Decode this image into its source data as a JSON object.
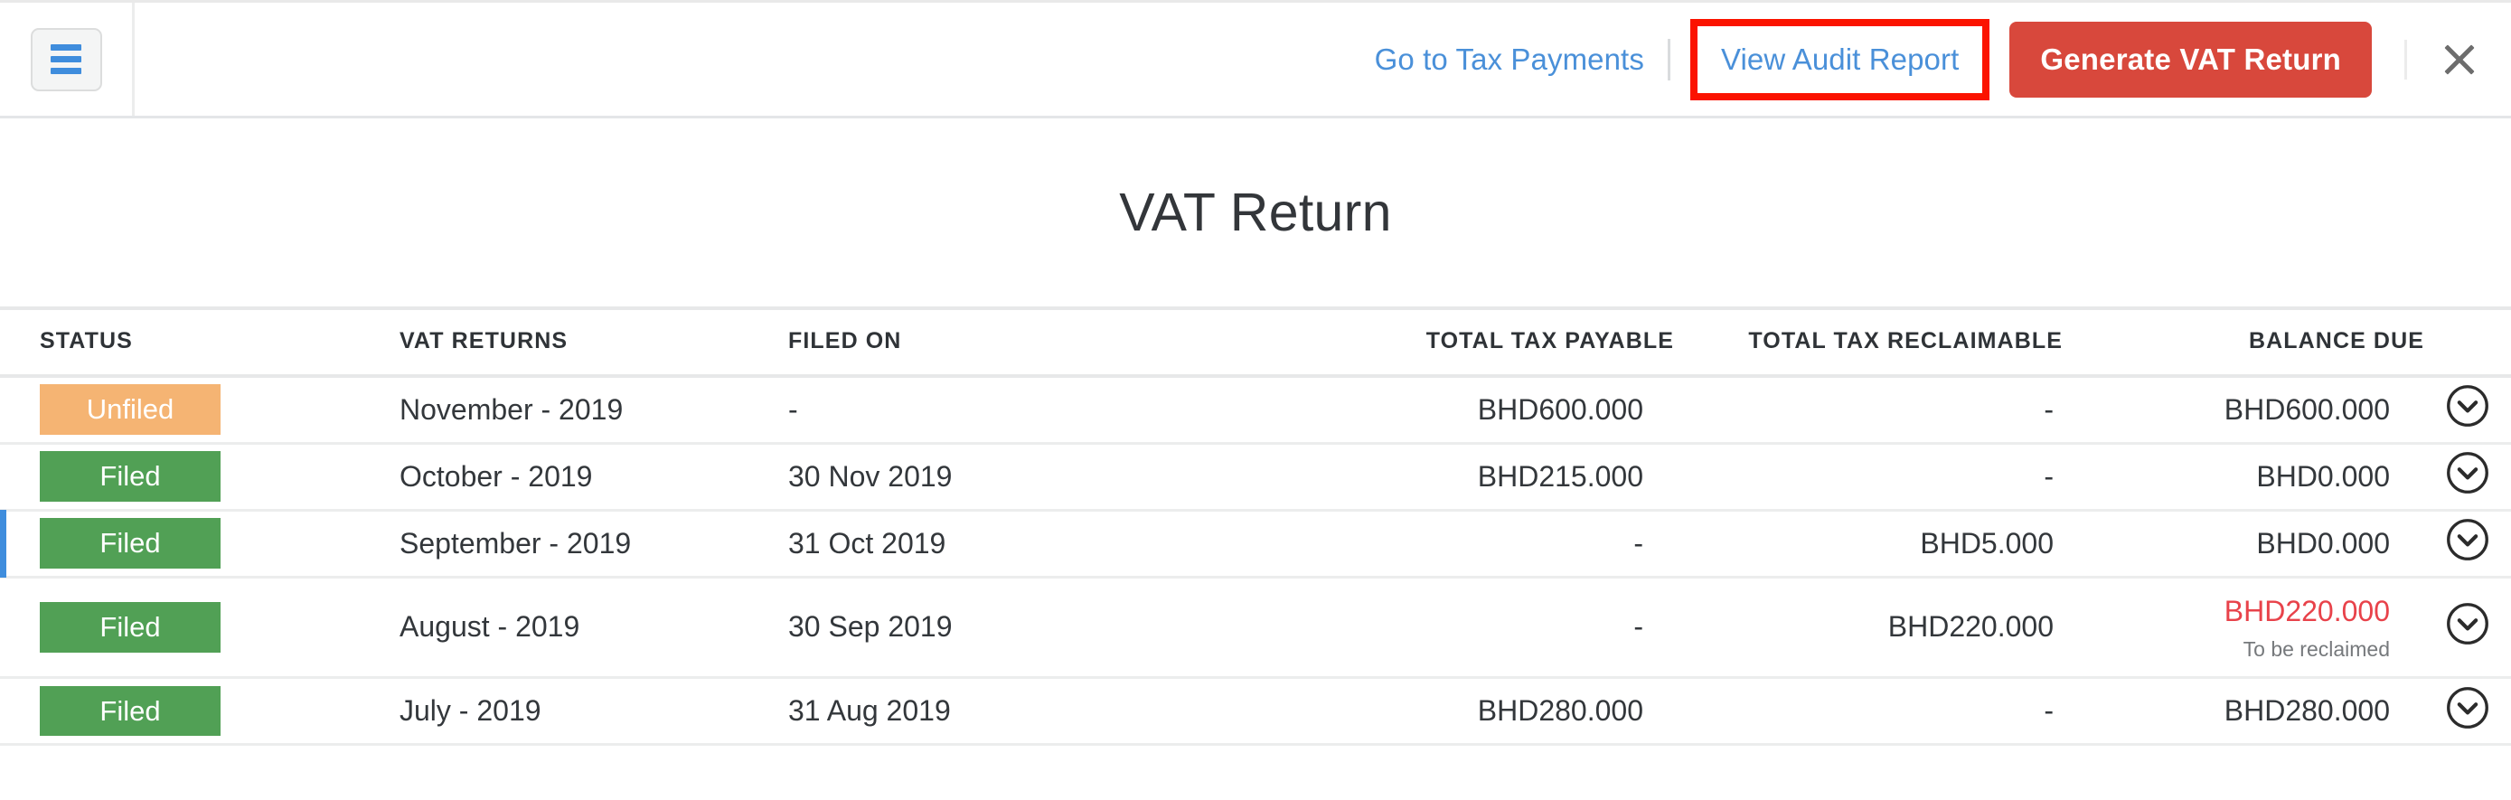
{
  "topbar": {
    "menu_icon": "hamburger-menu-icon",
    "tax_payments_link": "Go to Tax Payments",
    "audit_report_link": "View Audit Report",
    "generate_button": "Generate VAT Return",
    "close_icon": "close-icon",
    "highlight_color": "#fb1300",
    "link_color": "#4a90d9",
    "button_color": "#d8483c"
  },
  "page": {
    "title": "VAT Return"
  },
  "table": {
    "columns": [
      "STATUS",
      "VAT RETURNS",
      "FILED ON",
      "TOTAL TAX PAYABLE",
      "TOTAL TAX RECLAIMABLE",
      "BALANCE DUE"
    ],
    "status_colors": {
      "Unfiled": "#f5b473",
      "Filed": "#51a055"
    },
    "rows": [
      {
        "status": "Unfiled",
        "status_kind": "unfiled",
        "vat_return": "November - 2019",
        "filed_on": "-",
        "tax_payable": "BHD600.000",
        "tax_reclaimable": "-",
        "balance_due": "BHD600.000",
        "balance_note": "",
        "balance_negative": false,
        "accented": false,
        "action_icon": "chevron-down-circle-icon"
      },
      {
        "status": "Filed",
        "status_kind": "filed",
        "vat_return": "October - 2019",
        "filed_on": "30 Nov 2019",
        "tax_payable": "BHD215.000",
        "tax_reclaimable": "-",
        "balance_due": "BHD0.000",
        "balance_note": "",
        "balance_negative": false,
        "accented": false,
        "action_icon": "chevron-down-circle-icon"
      },
      {
        "status": "Filed",
        "status_kind": "filed",
        "vat_return": "September - 2019",
        "filed_on": "31 Oct 2019",
        "tax_payable": "-",
        "tax_reclaimable": "BHD5.000",
        "balance_due": "BHD0.000",
        "balance_note": "",
        "balance_negative": false,
        "accented": true,
        "action_icon": "chevron-down-circle-icon"
      },
      {
        "status": "Filed",
        "status_kind": "filed",
        "vat_return": "August - 2019",
        "filed_on": "30 Sep 2019",
        "tax_payable": "-",
        "tax_reclaimable": "BHD220.000",
        "balance_due": "BHD220.000",
        "balance_note": "To be reclaimed",
        "balance_negative": true,
        "accented": false,
        "action_icon": "chevron-down-circle-icon"
      },
      {
        "status": "Filed",
        "status_kind": "filed",
        "vat_return": "July - 2019",
        "filed_on": "31 Aug 2019",
        "tax_payable": "BHD280.000",
        "tax_reclaimable": "-",
        "balance_due": "BHD280.000",
        "balance_note": "",
        "balance_negative": false,
        "accented": false,
        "action_icon": "chevron-down-circle-icon"
      }
    ]
  }
}
